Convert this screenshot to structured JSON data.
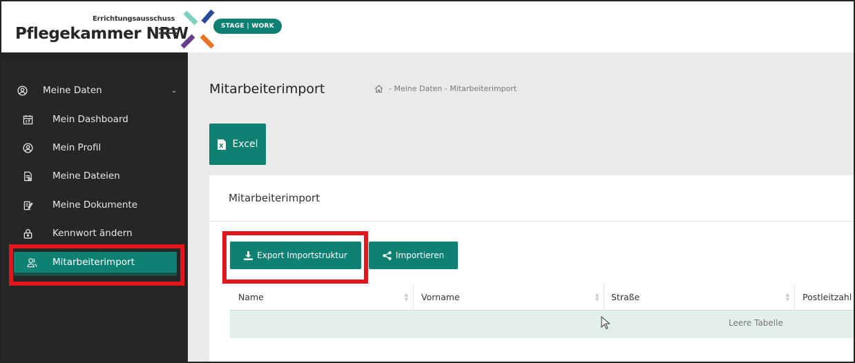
{
  "header": {
    "brand_small": "Errichtungsausschuss",
    "brand_main": "Pflegekammer NRW",
    "stage_badge": "STAGE | WORK",
    "colors": {
      "teal": "#0e8172",
      "mint": "#7fcfc0",
      "navy": "#2b4a9a",
      "purple": "#6a3c8c",
      "orange": "#e8742a"
    }
  },
  "sidebar": {
    "group": {
      "label": "Meine Daten",
      "icon": "user-circle-icon",
      "chevron": "chevron-down-icon"
    },
    "items": [
      {
        "label": "Mein Dashboard",
        "icon": "calendar-icon"
      },
      {
        "label": "Mein Profil",
        "icon": "user-circle-icon"
      },
      {
        "label": "Meine Dateien",
        "icon": "file-icon"
      },
      {
        "label": "Meine Dokumente",
        "icon": "document-edit-icon"
      },
      {
        "label": "Kennwort ändern",
        "icon": "lock-icon"
      },
      {
        "label": "Mitarbeiterimport",
        "icon": "users-icon",
        "active": true
      }
    ]
  },
  "main": {
    "page_title": "Mitarbeiterimport",
    "breadcrumb": {
      "home_icon": "home-icon",
      "text": "- Meine Daten - Mitarbeiterimport"
    },
    "excel_button": "Excel",
    "card": {
      "title": "Mitarbeiterimport",
      "export_button": "Export Importstruktur",
      "import_button": "Importieren",
      "table": {
        "columns": [
          "Name",
          "Vorname",
          "Straße",
          "Postleitzahl"
        ],
        "empty_text": "Leere Tabelle"
      }
    }
  },
  "highlight_color": "#e2171e"
}
